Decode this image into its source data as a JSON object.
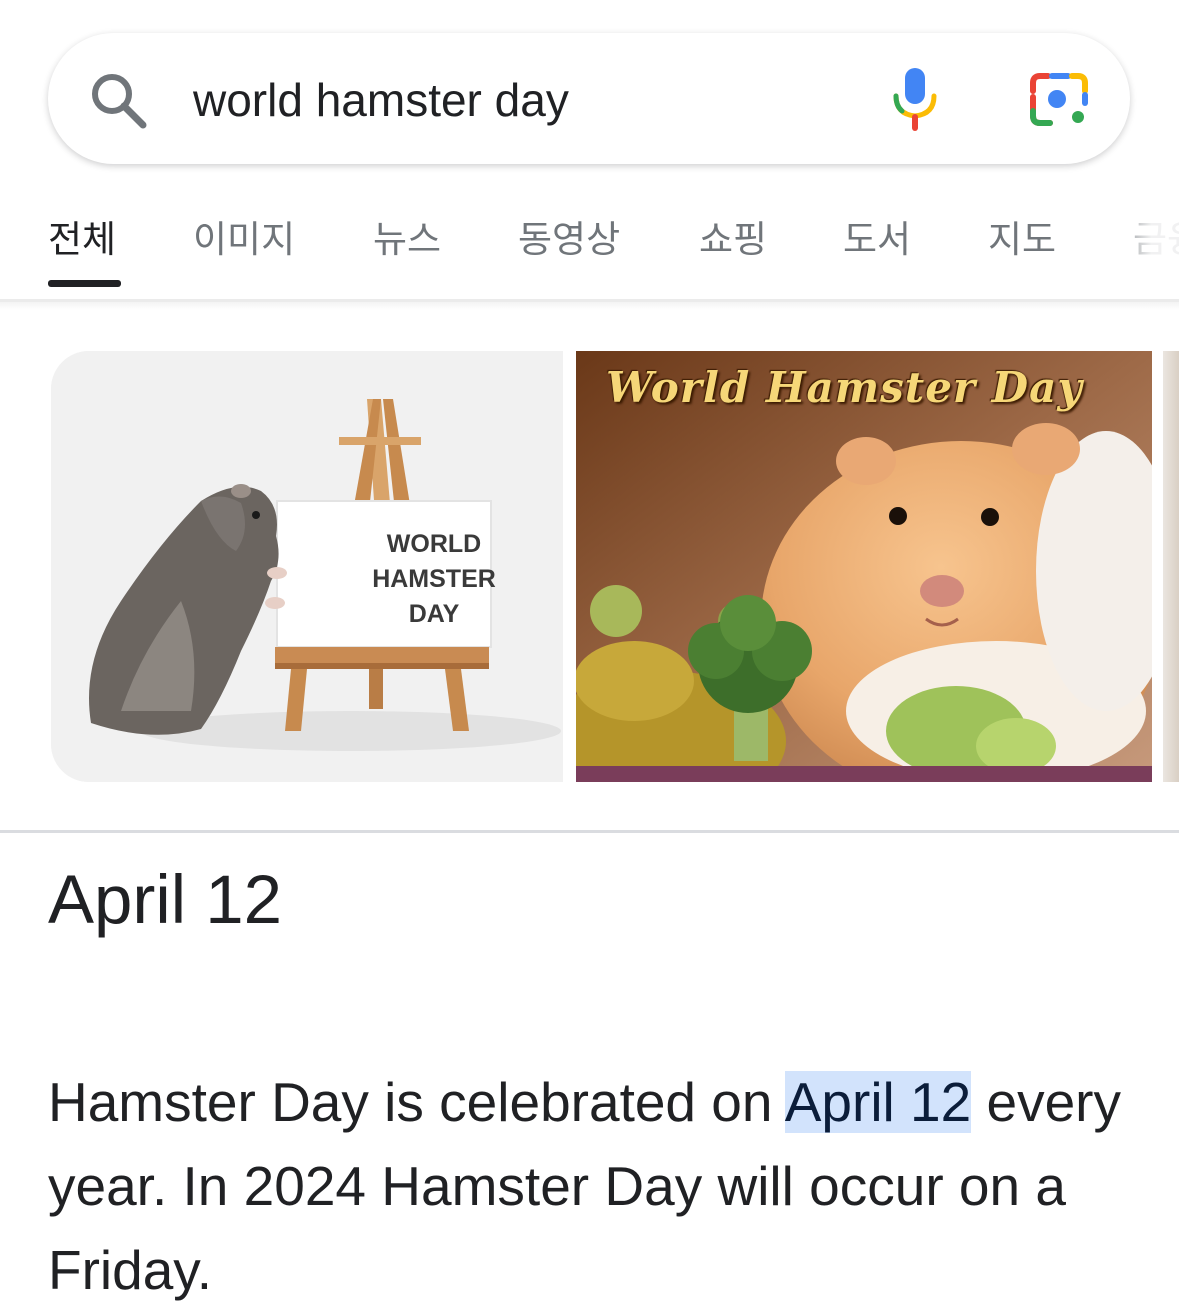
{
  "search": {
    "query": "world hamster day"
  },
  "tabs": [
    {
      "label": "전체",
      "active": true
    },
    {
      "label": "이미지"
    },
    {
      "label": "뉴스"
    },
    {
      "label": "동영상"
    },
    {
      "label": "쇼핑"
    },
    {
      "label": "도서"
    },
    {
      "label": "지도"
    },
    {
      "label": "금융"
    }
  ],
  "images": [
    {
      "sign_lines": [
        "WORLD",
        "HAMSTER",
        "DAY"
      ]
    },
    {
      "caption": "World Hamster Day"
    }
  ],
  "answer": {
    "heading": "April 12",
    "text_before": "Hamster Day is celebrated on ",
    "highlight": "April 12",
    "text_after": " every year. In 2024 Hamster Day will occur on a Friday."
  },
  "colors": {
    "highlight": "#d2e3fc",
    "mic_blue": "#4285f4",
    "mic_red": "#ea4335",
    "mic_yellow": "#fbbc05",
    "mic_green": "#34a853"
  }
}
